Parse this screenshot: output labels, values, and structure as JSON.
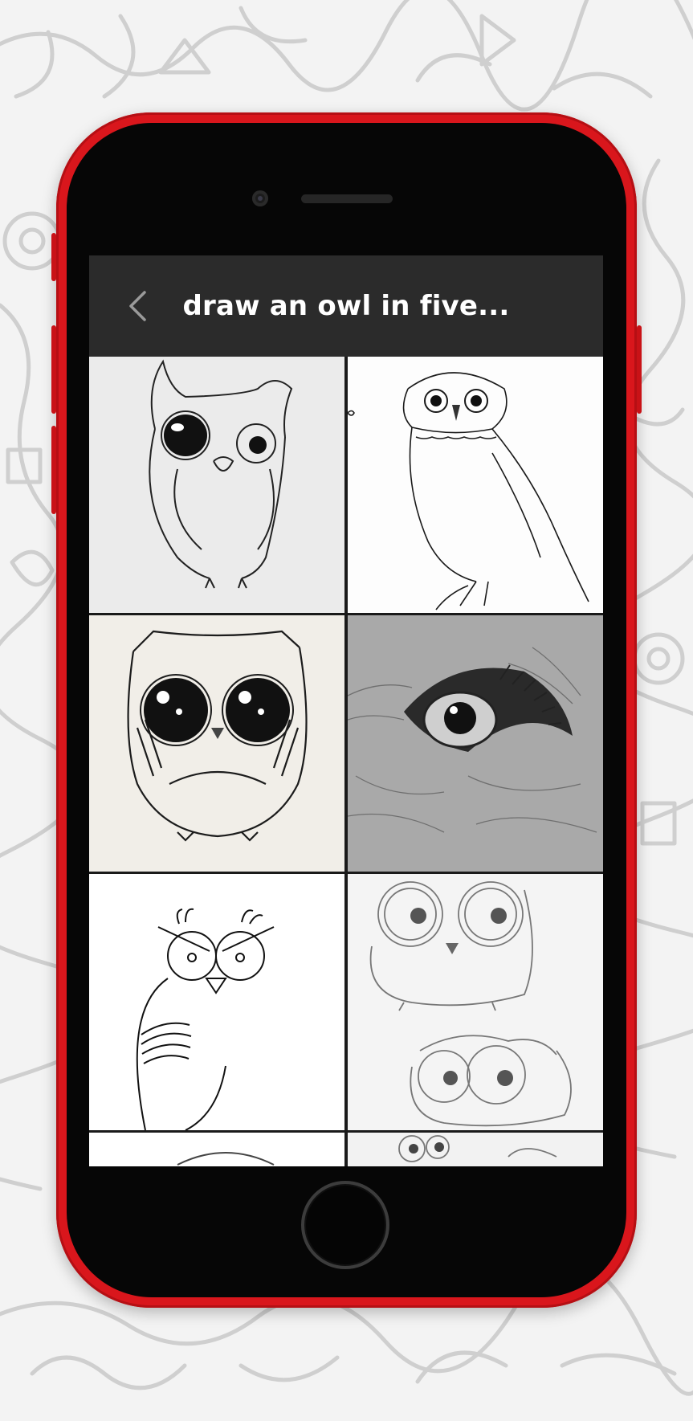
{
  "app_bar": {
    "title": "draw an owl in five...",
    "back_icon": "chevron-left-icon"
  },
  "gallery": {
    "items": [
      {
        "name": "owl-drawing-cartoon-big-eye"
      },
      {
        "name": "owl-drawing-realistic-perched"
      },
      {
        "name": "owl-drawing-cute-shaded"
      },
      {
        "name": "owl-drawing-eye-closeup"
      },
      {
        "name": "owl-drawing-simple-lines"
      },
      {
        "name": "owl-drawing-pencil-sketch-pair"
      },
      {
        "name": "owl-drawing-partial-1"
      },
      {
        "name": "owl-drawing-partial-2"
      }
    ]
  },
  "colors": {
    "phone_body": "#d9161c",
    "app_bar": "#2b2b2b",
    "title_text": "#ffffff"
  }
}
